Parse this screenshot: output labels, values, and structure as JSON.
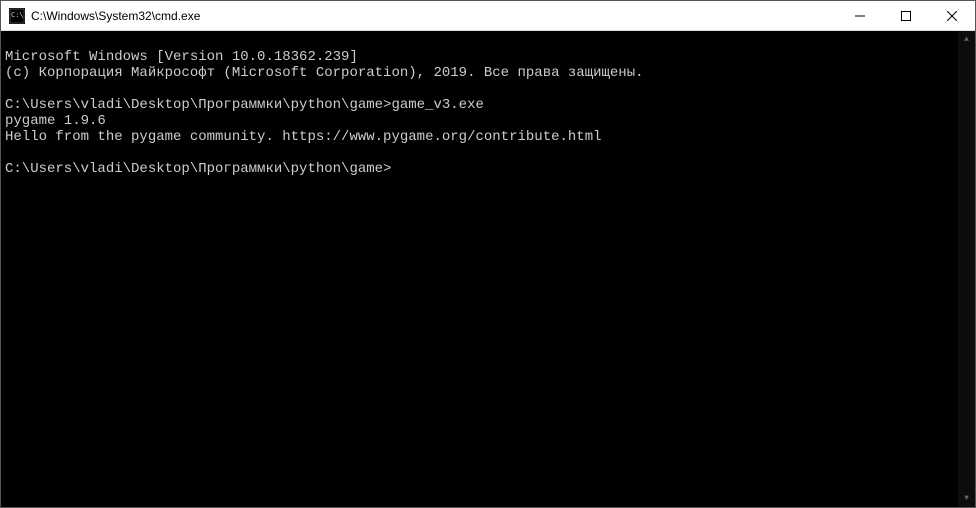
{
  "window": {
    "title": "C:\\Windows\\System32\\cmd.exe"
  },
  "console": {
    "lines": {
      "version": "Microsoft Windows [Version 10.0.18362.239]",
      "copyright": "(c) Корпорация Майкрософт (Microsoft Corporation), 2019. Все права защищены.",
      "blank1": "",
      "prompt1": "C:\\Users\\vladi\\Desktop\\Программки\\python\\game>",
      "cmd1": "game_v3.exe",
      "pygame": "pygame 1.9.6",
      "hello": "Hello from the pygame community. https://www.pygame.org/contribute.html",
      "blank2": "",
      "prompt2": "C:\\Users\\vladi\\Desktop\\Программки\\python\\game>"
    }
  }
}
